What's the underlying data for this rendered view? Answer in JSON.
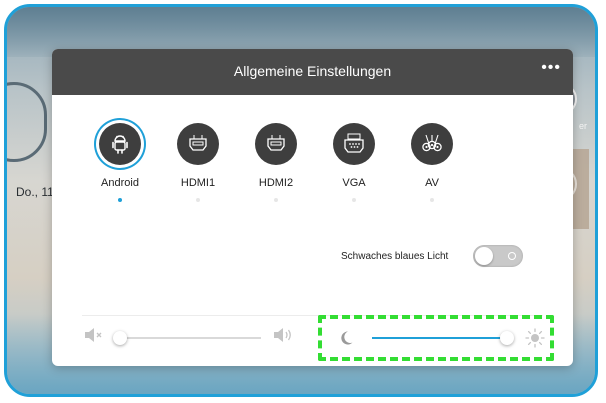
{
  "background": {
    "date_fragment": "Do., 11",
    "right_label_fragment": "er"
  },
  "dialog": {
    "title": "Allgemeine Einstellungen",
    "more_label": "•••"
  },
  "sources": [
    {
      "label": "Android",
      "icon": "android-icon",
      "selected": true
    },
    {
      "label": "HDMI1",
      "icon": "hdmi-icon",
      "selected": false
    },
    {
      "label": "HDMI2",
      "icon": "hdmi-icon",
      "selected": false
    },
    {
      "label": "VGA",
      "icon": "vga-icon",
      "selected": false
    },
    {
      "label": "AV",
      "icon": "av-icon",
      "selected": false
    }
  ],
  "blue_light": {
    "label": "Schwaches blaues Licht",
    "enabled": false
  },
  "volume": {
    "level": 0.0
  },
  "brightness": {
    "level": 1.0
  },
  "colors": {
    "accent": "#1fa0d8",
    "titlebar": "#4a4a4a",
    "highlight": "#33dd33"
  }
}
